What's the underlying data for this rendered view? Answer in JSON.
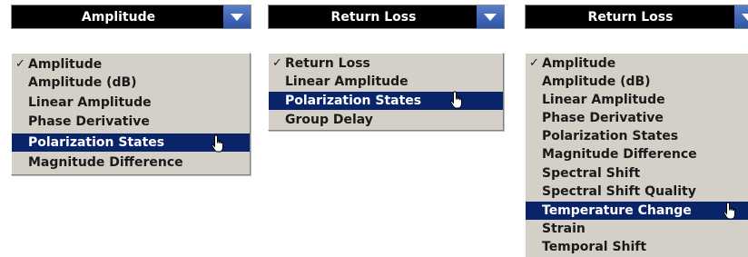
{
  "dropdowns": [
    {
      "selected_label": "Amplitude",
      "items": [
        {
          "label": "Amplitude",
          "checked": true
        },
        {
          "label": "Amplitude (dB)"
        },
        {
          "label": "Linear Amplitude"
        },
        {
          "label": "Phase Derivative"
        },
        {
          "label": "Polarization States",
          "highlighted": true
        },
        {
          "label": "Magnitude Difference"
        }
      ]
    },
    {
      "selected_label": "Return Loss",
      "items": [
        {
          "label": "Return Loss",
          "checked": true
        },
        {
          "label": "Linear Amplitude"
        },
        {
          "label": "Polarization States",
          "highlighted": true
        },
        {
          "label": "Group Delay"
        }
      ]
    },
    {
      "selected_label": "Return Loss",
      "items": [
        {
          "label": "Amplitude",
          "checked": true
        },
        {
          "label": "Amplitude (dB)"
        },
        {
          "label": "Linear Amplitude"
        },
        {
          "label": "Phase Derivative"
        },
        {
          "label": "Polarization States"
        },
        {
          "label": "Magnitude Difference"
        },
        {
          "label": "Spectral Shift"
        },
        {
          "label": "Spectral Shift Quality"
        },
        {
          "label": "Temperature Change",
          "highlighted": true
        },
        {
          "label": "Strain"
        },
        {
          "label": "Temporal Shift"
        }
      ]
    }
  ],
  "check_mark": "✓",
  "colors": {
    "header_bg": "#000000",
    "arrow_bg": "#3a62b4",
    "menu_bg": "#d4d0c8",
    "highlight_bg": "#0a246a",
    "highlight_text": "#ffffff"
  },
  "icons": [
    "chevron-down-icon",
    "checkmark-icon",
    "hand-pointer-cursor-icon"
  ]
}
